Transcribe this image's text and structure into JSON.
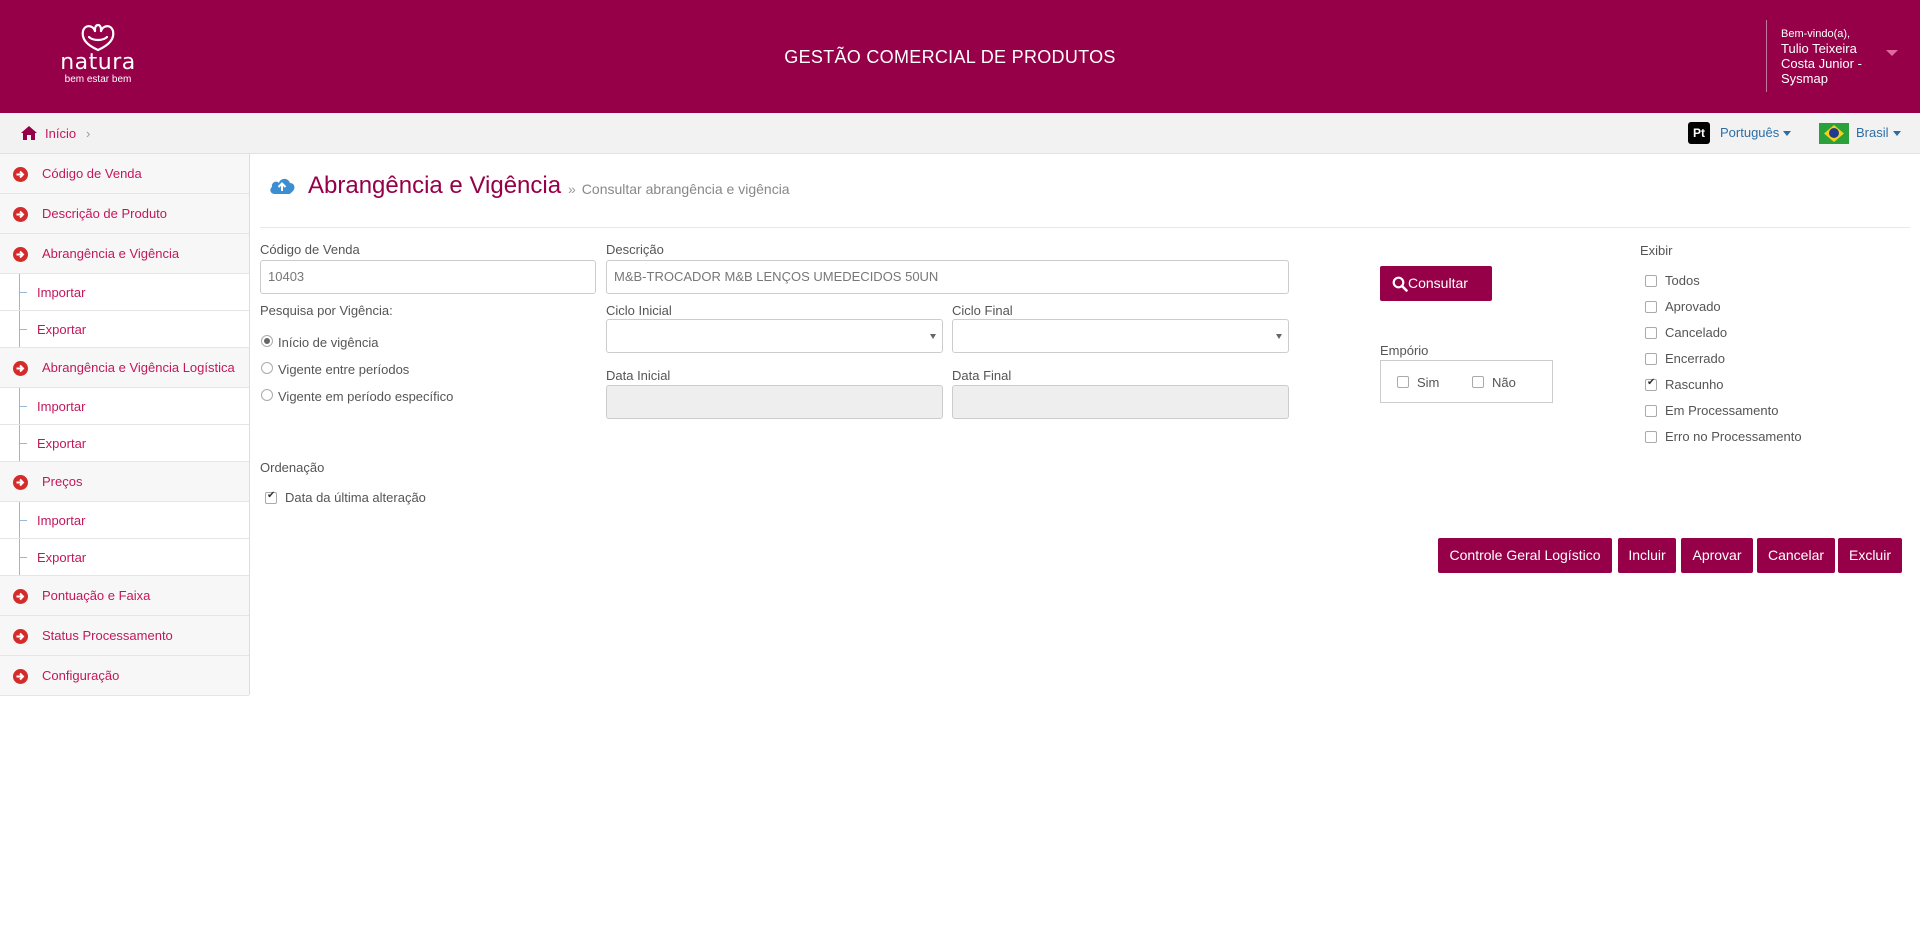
{
  "header": {
    "logo_word": "natura",
    "logo_tagline": "bem estar bem",
    "app_title": "GESTÃO COMERCIAL DE PRODUTOS",
    "user_greeting": "Bem-vindo(a),",
    "user_name": "Tulio Teixeira Costa Junior - Sysmap"
  },
  "breadcrumb": {
    "home_label": "Início",
    "separator": "›"
  },
  "locale": {
    "language_badge": "Pt",
    "language_label": "Português",
    "country_label": "Brasil"
  },
  "sidebar": {
    "items": [
      {
        "label": "Código de Venda"
      },
      {
        "label": "Descrição de Produto"
      },
      {
        "label": "Abrangência e Vigência"
      },
      {
        "label": "Importar"
      },
      {
        "label": "Exportar"
      },
      {
        "label": "Abrangência e Vigência Logística"
      },
      {
        "label": "Importar"
      },
      {
        "label": "Exportar"
      },
      {
        "label": "Preços"
      },
      {
        "label": "Importar"
      },
      {
        "label": "Exportar"
      },
      {
        "label": "Pontuação e Faixa"
      },
      {
        "label": "Status Processamento"
      },
      {
        "label": "Configuração"
      }
    ]
  },
  "page": {
    "title": "Abrangência e Vigência",
    "subtitle_sep": "»",
    "subtitle": "Consultar abrangência e vigência"
  },
  "form": {
    "codigo_label": "Código de Venda",
    "codigo_value": "10403",
    "descricao_label": "Descrição",
    "descricao_value": "M&B-TROCADOR M&B LENÇOS UMEDECIDOS 50UN",
    "pesquisa_label": "Pesquisa por Vigência:",
    "pesquisa_options": [
      {
        "label": "Início de vigência",
        "checked": true
      },
      {
        "label": "Vigente entre períodos",
        "checked": false
      },
      {
        "label": "Vigente em período específico",
        "checked": false
      }
    ],
    "ciclo_inicial_label": "Ciclo Inicial",
    "ciclo_inicial_value": "",
    "ciclo_final_label": "Ciclo Final",
    "ciclo_final_value": "",
    "data_inicial_label": "Data Inicial",
    "data_final_label": "Data Final",
    "consultar_label": "Consultar",
    "emporio_label": "Empório",
    "emporio_sim": "Sim",
    "emporio_nao": "Não",
    "exibir_label": "Exibir",
    "exibir_options": [
      {
        "label": "Todos",
        "checked": false
      },
      {
        "label": "Aprovado",
        "checked": false
      },
      {
        "label": "Cancelado",
        "checked": false
      },
      {
        "label": "Encerrado",
        "checked": false
      },
      {
        "label": "Rascunho",
        "checked": true
      },
      {
        "label": "Em Processamento",
        "checked": false
      },
      {
        "label": "Erro no Processamento",
        "checked": false
      }
    ],
    "ordenacao_label": "Ordenação",
    "ordenacao_option": "Data da última alteração",
    "ordenacao_checked": true
  },
  "actions": {
    "controle": "Controle Geral Logístico",
    "incluir": "Incluir",
    "aprovar": "Aprovar",
    "cancelar": "Cancelar",
    "excluir": "Excluir"
  },
  "colors": {
    "brand": "#960048",
    "link": "#c2185b",
    "accent_blue": "#2e6da4"
  }
}
